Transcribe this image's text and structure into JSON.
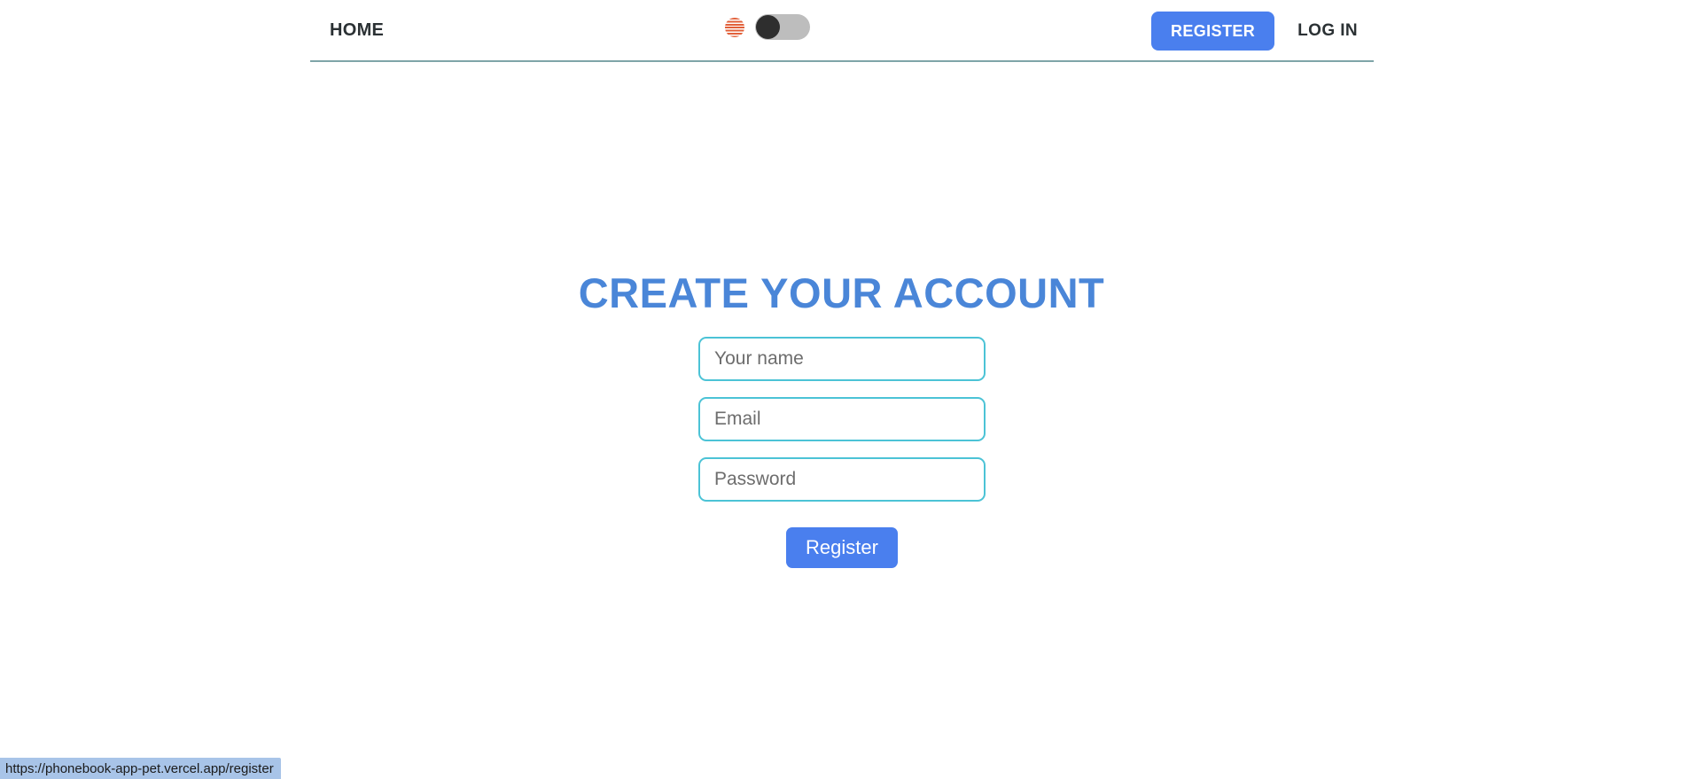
{
  "header": {
    "home_label": "HOME",
    "theme": {
      "icon_name": "sun-icon",
      "toggle_state": "off"
    },
    "register_label": "REGISTER",
    "login_label": "LOG IN",
    "accent_color": "#4a7fee",
    "border_color": "#7fa5a8"
  },
  "main": {
    "title": "CREATE YOUR ACCOUNT",
    "title_color": "#4a86d8",
    "form": {
      "name": {
        "placeholder": "Your name",
        "value": ""
      },
      "email": {
        "placeholder": "Email",
        "value": ""
      },
      "password": {
        "placeholder": "Password",
        "value": ""
      },
      "submit_label": "Register",
      "field_border_color": "#4cc3d6"
    }
  },
  "browser": {
    "status_url": "https://phonebook-app-pet.vercel.app/register"
  }
}
